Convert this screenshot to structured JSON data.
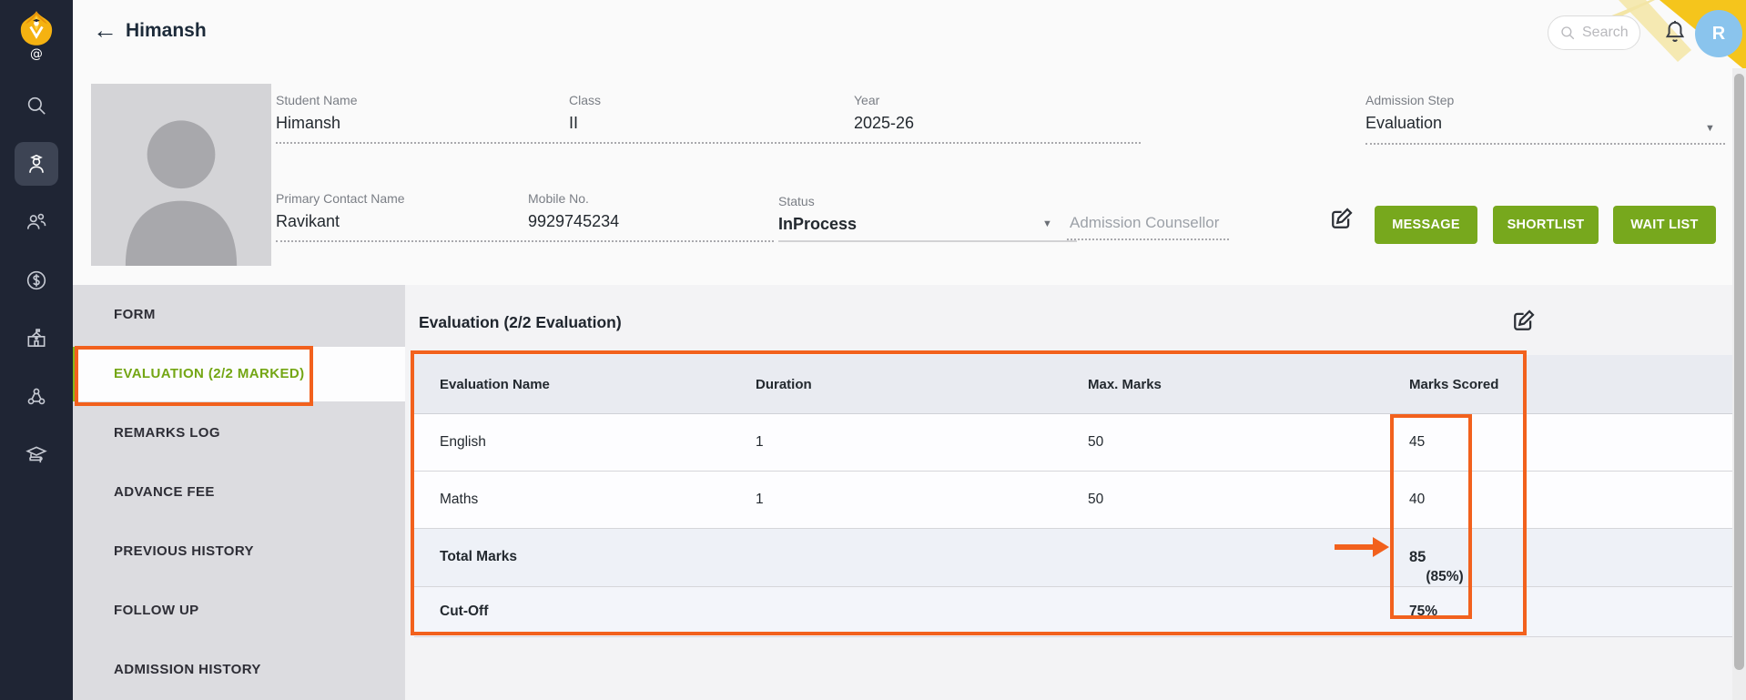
{
  "app": {
    "title": "Himansh",
    "search_placeholder": "Search",
    "avatar_initial": "R"
  },
  "sidebar": {
    "items": [
      {
        "icon": "search"
      },
      {
        "icon": "student",
        "active": true
      },
      {
        "icon": "people"
      },
      {
        "icon": "fees"
      },
      {
        "icon": "school"
      },
      {
        "icon": "community"
      },
      {
        "icon": "academics"
      }
    ]
  },
  "student": {
    "fields": {
      "student_name": {
        "label": "Student Name",
        "value": "Himansh"
      },
      "class": {
        "label": "Class",
        "value": "II"
      },
      "year": {
        "label": "Year",
        "value": "2025-26"
      },
      "admission_step": {
        "label": "Admission Step",
        "value": "Evaluation"
      },
      "primary_contact": {
        "label": "Primary Contact Name",
        "value": "Ravikant"
      },
      "mobile": {
        "label": "Mobile No.",
        "value": "9929745234"
      },
      "status": {
        "label": "Status",
        "value": "InProcess"
      }
    },
    "counsellor_placeholder": "Admission Counsellor",
    "buttons": {
      "message": "MESSAGE",
      "shortlist": "SHORTLIST",
      "waitlist": "WAIT LIST"
    }
  },
  "subnav": {
    "items": [
      {
        "label": "FORM"
      },
      {
        "label": "EVALUATION (2/2 MARKED)",
        "active": true
      },
      {
        "label": "REMARKS LOG"
      },
      {
        "label": "ADVANCE FEE"
      },
      {
        "label": "PREVIOUS HISTORY"
      },
      {
        "label": "FOLLOW UP"
      },
      {
        "label": "ADMISSION HISTORY"
      }
    ]
  },
  "evaluation": {
    "heading": "Evaluation (2/2 Evaluation)",
    "table": {
      "headers": [
        "Evaluation Name",
        "Duration",
        "Max. Marks",
        "Marks Scored"
      ],
      "rows": [
        {
          "name": "English",
          "duration": "1",
          "max": "50",
          "scored": "45"
        },
        {
          "name": "Maths",
          "duration": "1",
          "max": "50",
          "scored": "40"
        },
        {
          "name": "Total Marks",
          "duration": "",
          "max": "",
          "scored": "85",
          "scored_note": "(85%)"
        },
        {
          "name": "Cut-Off",
          "duration": "",
          "max": "",
          "scored": "75%"
        }
      ]
    }
  },
  "colors": {
    "sidebar_navy": "#1f2534",
    "accent_green": "#77a81d",
    "nav_active_green": "#74a614",
    "annotation_orange": "#f2611d",
    "avatar_blue": "#8ac4ed",
    "logo_yellow": "#f5b211"
  }
}
